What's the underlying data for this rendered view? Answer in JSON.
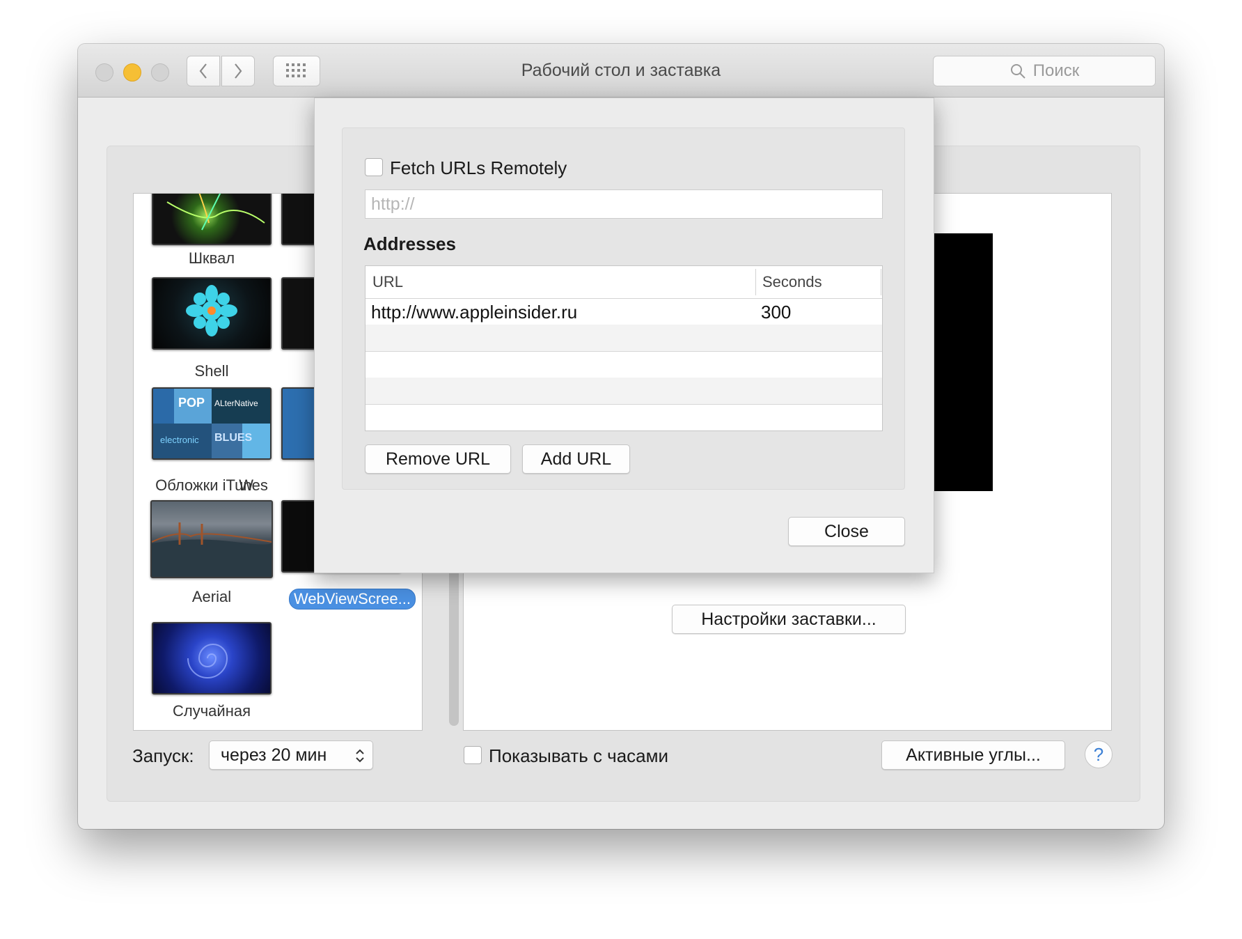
{
  "window": {
    "title": "Рабочий стол и заставка",
    "search_placeholder": "Поиск"
  },
  "screensavers": [
    {
      "label": "Шквал"
    },
    {
      "label": "Shell"
    },
    {
      "label": "Обложки iTunes"
    },
    {
      "label": "Aerial"
    },
    {
      "label": "Случайная"
    },
    {
      "label": "W"
    },
    {
      "label": "WebViewScree..."
    }
  ],
  "thumb_texts": {
    "pop": "POP",
    "alternative": "ALterNative",
    "electronic": "electronic",
    "blues": "BLUES"
  },
  "preview": {
    "options_button": "Настройки заставки..."
  },
  "bottom": {
    "start_label": "Запуск:",
    "start_value": "через 20 мин",
    "show_clock_label": "Показывать с часами",
    "hot_corners_button": "Активные углы...",
    "help": "?"
  },
  "sheet": {
    "fetch_label": "Fetch URLs Remotely",
    "url_placeholder": "http://",
    "addresses_title": "Addresses",
    "columns": {
      "url": "URL",
      "seconds": "Seconds"
    },
    "rows": [
      {
        "url": "http://www.appleinsider.ru",
        "seconds": "300"
      }
    ],
    "remove_button": "Remove URL",
    "add_button": "Add URL",
    "close_button": "Close"
  },
  "colors": {
    "selection": "#4a90e2",
    "minimize": "#f6bf35"
  }
}
